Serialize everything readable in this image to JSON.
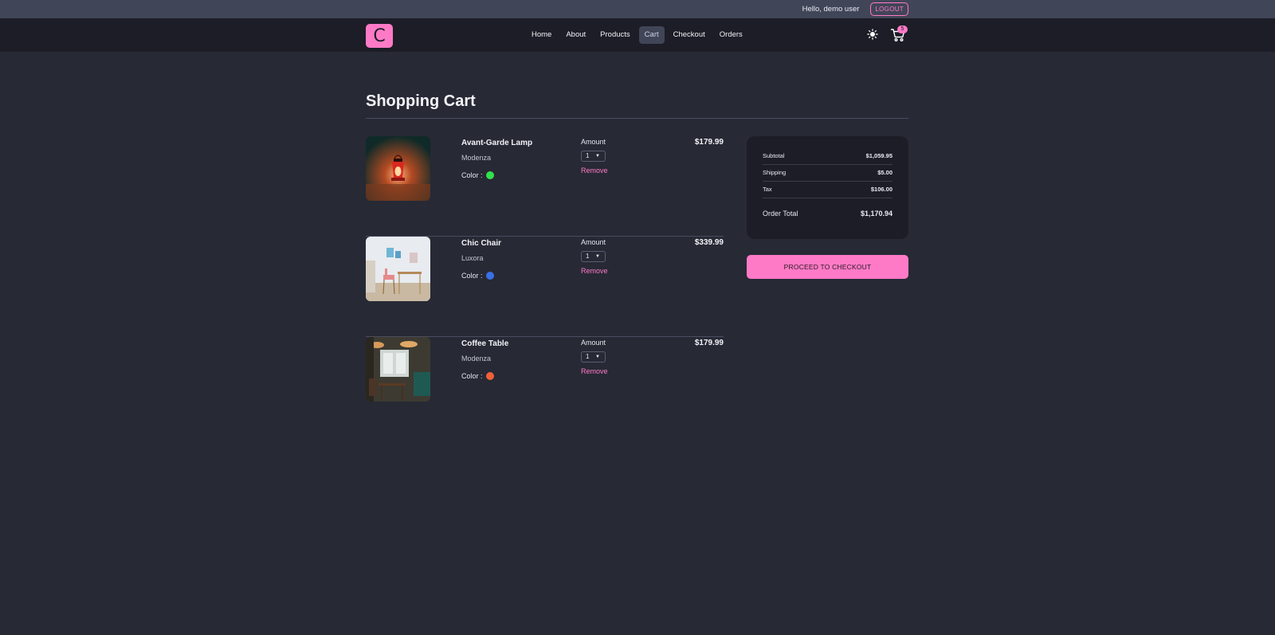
{
  "topbar": {
    "greeting": "Hello, demo user",
    "logout_label": "LOGOUT"
  },
  "navbar": {
    "logo_letter": "C",
    "links": [
      {
        "label": "Home",
        "active": false
      },
      {
        "label": "About",
        "active": false
      },
      {
        "label": "Products",
        "active": false
      },
      {
        "label": "Cart",
        "active": true
      },
      {
        "label": "Checkout",
        "active": false
      },
      {
        "label": "Orders",
        "active": false
      }
    ],
    "theme_icon": "sun-icon",
    "cart_icon": "cart-icon",
    "cart_count": "5"
  },
  "page": {
    "title": "Shopping Cart"
  },
  "cart_items": [
    {
      "name": "Avant-Garde Lamp",
      "brand": "Modenza",
      "color_label": "Color :",
      "color": "#33e14a",
      "amount_label": "Amount",
      "amount": "1",
      "remove_label": "Remove",
      "price": "$179.99"
    },
    {
      "name": "Chic Chair",
      "brand": "Luxora",
      "color_label": "Color :",
      "color": "#3a6fe6",
      "amount_label": "Amount",
      "amount": "1",
      "remove_label": "Remove",
      "price": "$339.99"
    },
    {
      "name": "Coffee Table",
      "brand": "Modenza",
      "color_label": "Color :",
      "color": "#f0603a",
      "amount_label": "Amount",
      "amount": "1",
      "remove_label": "Remove",
      "price": "$179.99"
    }
  ],
  "summary": {
    "subtotal_label": "Subtotal",
    "subtotal": "$1,059.95",
    "shipping_label": "Shipping",
    "shipping": "$5.00",
    "tax_label": "Tax",
    "tax": "$106.00",
    "total_label": "Order Total",
    "total": "$1,170.94"
  },
  "checkout_label": "PROCEED TO CHECKOUT",
  "colors": {
    "accent": "#ff7ac6",
    "background": "#272935",
    "navbar": "#1c1d26",
    "topbar": "#414558"
  }
}
